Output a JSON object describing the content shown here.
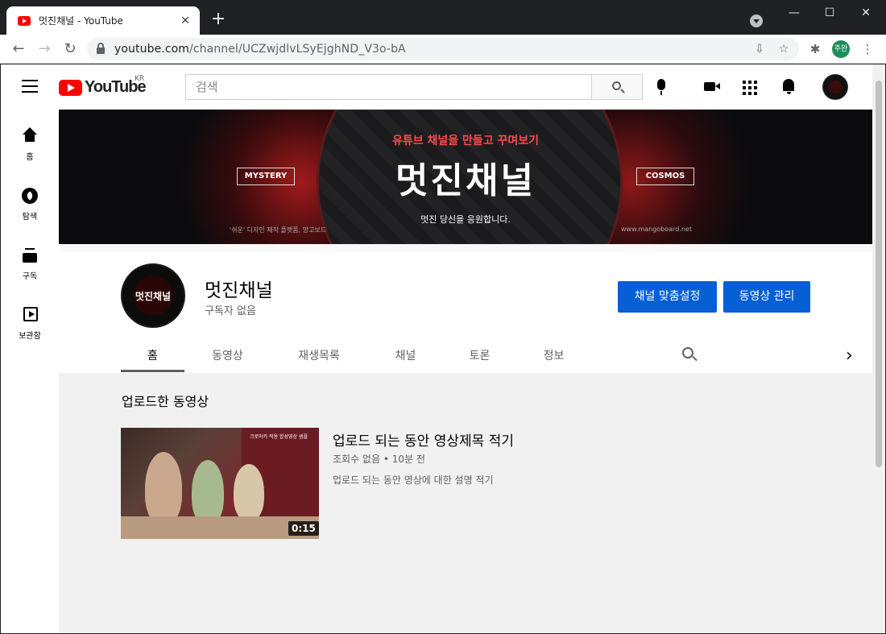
{
  "browser": {
    "tab_title": "멋진채널 - YouTube",
    "tab_close": "✕",
    "new_tab": "+",
    "url_host": "youtube.com",
    "url_path": "/channel/UCZwjdlvLSyEjghND_V3o-bA",
    "profile_label": "주완",
    "window_minimize": "—",
    "window_maximize": "☐",
    "window_close": "✕",
    "back": "←",
    "forward": "→",
    "reload": "↻",
    "install_icon": "⇩",
    "star_icon": "☆",
    "extensions_icon": "✱",
    "menu_icon": "⋮"
  },
  "youtube": {
    "logo_text": "YouTube",
    "country": "KR",
    "search_placeholder": "검색",
    "brand_color": "#ff0000",
    "accent_color": "#065fd4"
  },
  "guide": {
    "items": [
      {
        "label": "홈",
        "icon": "home-icon"
      },
      {
        "label": "탐색",
        "icon": "explore-icon"
      },
      {
        "label": "구독",
        "icon": "subscriptions-icon"
      },
      {
        "label": "보관함",
        "icon": "library-icon"
      }
    ]
  },
  "banner": {
    "subtitle": "유튜브 채널을 만들고 꾸며보기",
    "title": "멋진채널",
    "tagline": "멋진 당신을 응원합니다.",
    "left_box": "MYSTERY",
    "right_box": "COSMOS",
    "credit_left": "'쉬운' 디자인 제작 플랫폼, 망고보드",
    "credit_right": "www.mangoboard.net"
  },
  "channel": {
    "avatar_text": "멋진채널",
    "name": "멋진채널",
    "subscribers": "구독자 없음",
    "customize_button": "채널 맞춤설정",
    "manage_button": "동영상 관리",
    "tabs": [
      "홈",
      "동영상",
      "재생목록",
      "채널",
      "토론",
      "정보"
    ],
    "active_tab": "홈"
  },
  "shelf": {
    "title": "업로드한 동영상",
    "video": {
      "title": "업로드 되는 동안 영상제목 적기",
      "meta": "조회수 없음 • 10분 전",
      "description": "업로드 되는 동안 영상에 대한 설명 적기",
      "duration": "0:15",
      "thumb_caption": "크로마키 적용 합성영상 샘플"
    }
  }
}
